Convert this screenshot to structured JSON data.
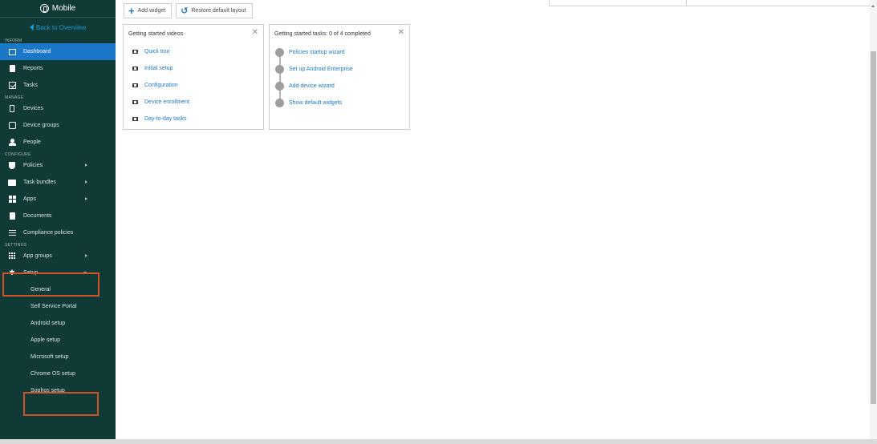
{
  "sidebar": {
    "brand": "Mobile",
    "back": "Back to Overview",
    "sections": {
      "inform": "INFORM",
      "manage": "MANAGE",
      "configure": "CONFIGURE",
      "settings": "SETTINGS"
    },
    "items": {
      "dashboard": "Dashboard",
      "reports": "Reports",
      "tasks": "Tasks",
      "devices": "Devices",
      "device_groups": "Device groups",
      "people": "People",
      "policies": "Policies",
      "task_bundles": "Task bundles",
      "apps": "Apps",
      "documents": "Documents",
      "compliance_policies": "Compliance policies",
      "app_groups": "App groups",
      "setup": "Setup"
    },
    "setup_sub": [
      "General",
      "Self Service Portal",
      "Android setup",
      "Apple setup",
      "Microsoft setup",
      "Chrome OS setup",
      "Sophos setup"
    ]
  },
  "toolbar": {
    "add_widget": "Add widget",
    "restore_layout": "Restore default layout"
  },
  "widgets": {
    "videos": {
      "title": "Getting started videos",
      "items": [
        "Quick tour",
        "Initial setup",
        "Configuration",
        "Device enrollment",
        "Day-to-day tasks"
      ]
    },
    "tasks": {
      "title": "Getting started tasks: 0 of 4 completed",
      "items": [
        "Policies startup wizard",
        "Set up Android Enterprise",
        "Add device wizard",
        "Show default widgets"
      ]
    }
  },
  "colors": {
    "sidebar_bg": "#0f3a36",
    "active_bg": "#1b78c9",
    "link": "#1b78c9",
    "highlight": "#d2522a"
  }
}
